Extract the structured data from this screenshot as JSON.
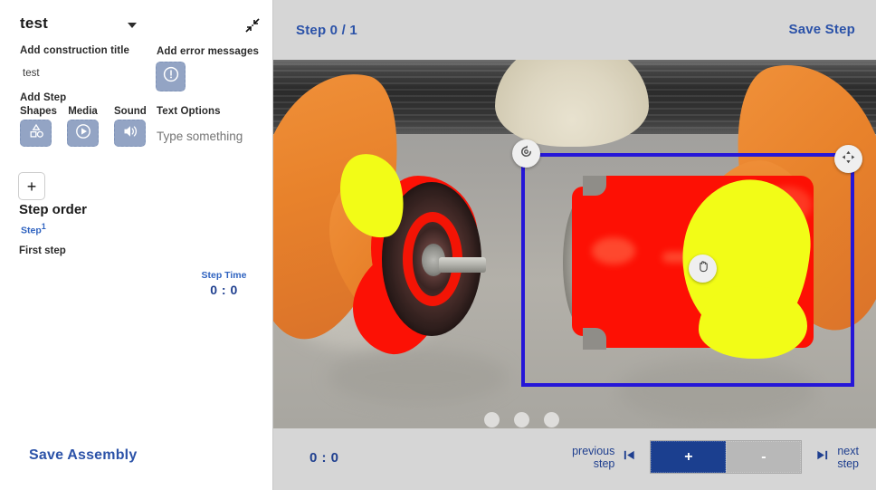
{
  "sidebar": {
    "title": "test",
    "collapse_icon": "collapse-diagonal-icon",
    "dropdown_icon": "chevron-down-icon",
    "construction_title_label": "Add construction title",
    "construction_title_value": "test",
    "error_messages_label": "Add error messages",
    "error_icon": "exclamation-circle-icon",
    "add_step_label": "Add Step",
    "tools": [
      {
        "label": "Shapes",
        "icon": "shapes-icon"
      },
      {
        "label": "Media",
        "icon": "play-circle-icon"
      },
      {
        "label": "Sound",
        "icon": "speaker-icon"
      }
    ],
    "text_options_label": "Text Options",
    "text_options_placeholder": "Type something",
    "text_options_value": "",
    "add_button_label": "+",
    "step_order_label": "Step order",
    "step_chip_label": "Step",
    "step_chip_number": "1",
    "step_description": "First step",
    "step_time_label": "Step Time",
    "step_time_value": "0 : 0",
    "save_assembly_label": "Save Assembly"
  },
  "main": {
    "step_counter": "Step 0 / 1",
    "save_step_label": "Save Step",
    "time_display": "0 : 0",
    "previous_step_label_line1": "previous",
    "previous_step_label_line2": "step",
    "next_step_label_line1": "next",
    "next_step_label_line2": "step",
    "previous_step_icon": "skip-back-icon",
    "next_step_icon": "skip-forward-icon",
    "plus_label": "+",
    "minus_label": "-",
    "selection": {
      "rotate_handle_icon": "rotate-icon",
      "move_handle_icon": "move-four-arrows-icon",
      "grab_handle_icon": "hand-grab-icon"
    },
    "overlay_dots": [
      "overlay-dot-1",
      "overlay-dot-2",
      "overlay-dot-3"
    ]
  },
  "colors": {
    "accent_blue": "#2b52a8",
    "deep_blue": "#1b3f8f",
    "selection_blue": "#2516d8",
    "panel_gray": "#d6d6d6",
    "tool_button": "#93a4c4",
    "segment_red": "#fc1105",
    "segment_yellow": "#f2fc17",
    "segment_orange": "#e8822b",
    "minus_gray": "#b8b8b8"
  }
}
